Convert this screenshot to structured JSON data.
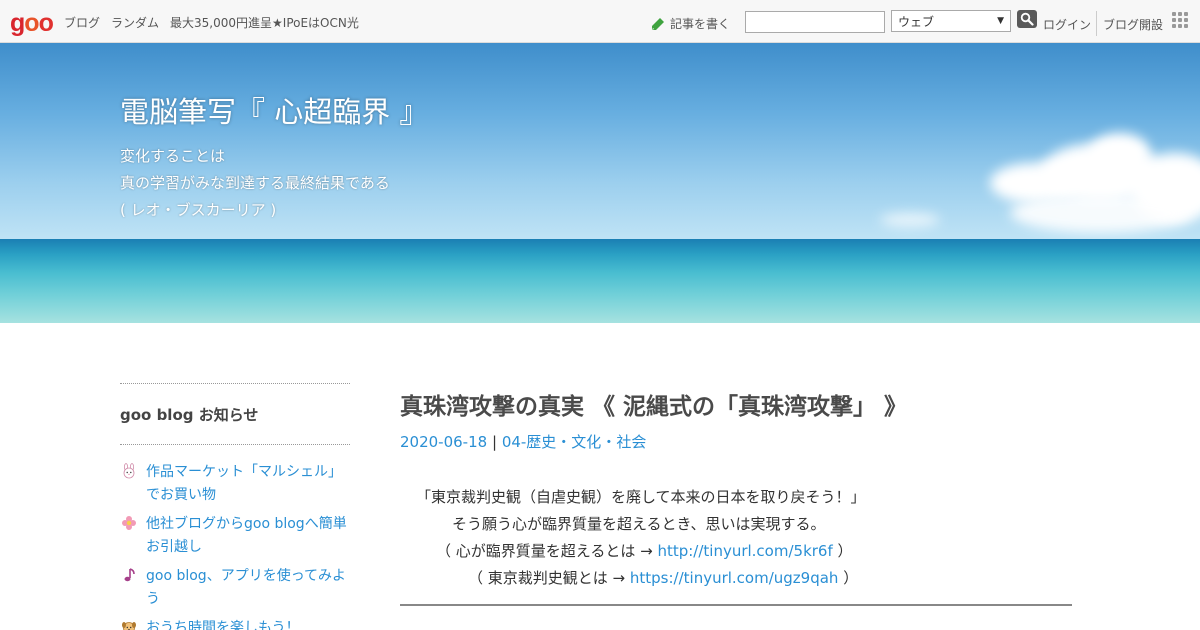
{
  "header": {
    "logo_letters": [
      "g",
      "o",
      "o"
    ],
    "nav": [
      "ブログ",
      "ランダム",
      "最大35,000円進呈★IPoEはOCN光"
    ],
    "write_label": "記事を書く",
    "search_value": "",
    "search_scope": "ウェブ",
    "login_label": "ログイン",
    "open_blog_label": "ブログ開設"
  },
  "hero": {
    "title": "電脳筆写『 心超臨界 』",
    "description_lines": [
      "変化することは",
      "真の学習がみな到達する最終結果である",
      "( レオ・ブスカーリア )"
    ]
  },
  "sidebar": {
    "heading": "goo blog お知らせ",
    "items": [
      {
        "icon": "rabbit-icon",
        "text": "作品マーケット「マルシェル」でお買い物"
      },
      {
        "icon": "flower-icon",
        "text": "他社ブログからgoo blogへ簡単お引越し"
      },
      {
        "icon": "music-note-icon",
        "text": "goo blog、アプリを使ってみよう"
      },
      {
        "icon": "dog-icon",
        "text": "おうち時間を楽しもう！"
      }
    ]
  },
  "post": {
    "title": "真珠湾攻撃の真実 《 泥縄式の「真珠湾攻撃」 》",
    "date": "2020-06-18",
    "separator": "|",
    "category": "04-歴史・文化・社会",
    "line1": "「東京裁判史観（自虐史観）を廃して本来の日本を取り戻そう！」",
    "line2": "そう願う心が臨界質量を超えるとき、思いは実現する。",
    "line3_prefix": "（ 心が臨界質量を超えるとは → ",
    "line3_link": "http://tinyurl.com/5kr6f",
    "line3_suffix": " ）",
    "line4_prefix": "（ 東京裁判史観とは → ",
    "line4_link": "https://tinyurl.com/ugz9qah",
    "line4_suffix": " ）"
  },
  "colors": {
    "logo_g": "#d9262e",
    "logo_o1": "#e8542a",
    "logo_o2": "#e0312f",
    "link": "#2a8fd4"
  }
}
